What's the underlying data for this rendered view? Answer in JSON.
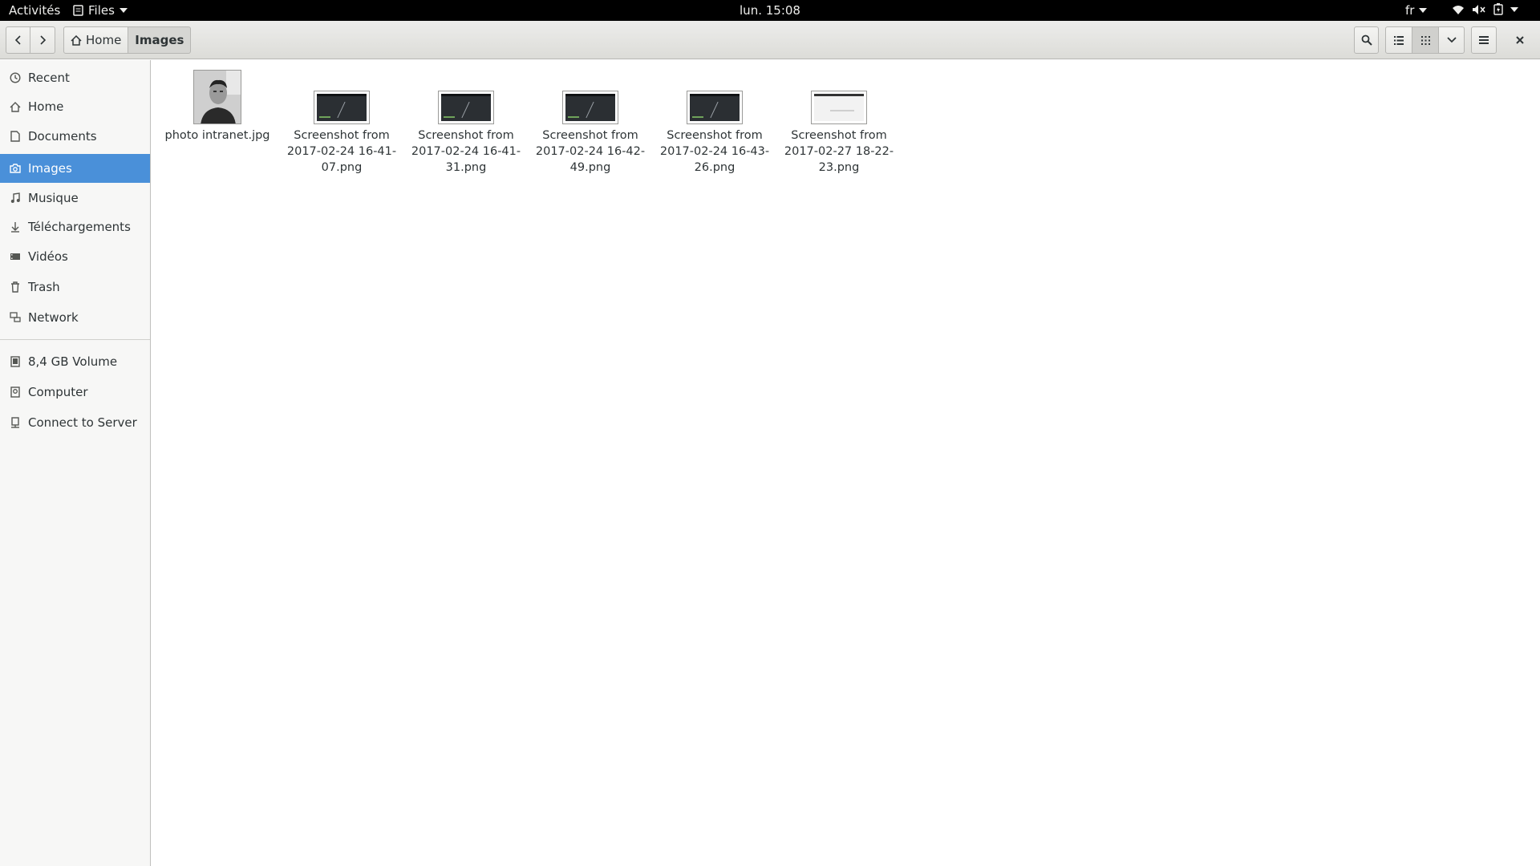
{
  "topbar": {
    "activities": "Activités",
    "app_name": "Files",
    "clock": "lun. 15:08",
    "language": "fr",
    "status_icons": [
      "wifi-icon",
      "volume-muted-icon",
      "battery-icon"
    ]
  },
  "headerbar": {
    "breadcrumbs": [
      "Home",
      "Images"
    ],
    "buttons": [
      "search-icon",
      "list-view-icon",
      "grid-view-icon",
      "chevron-down-icon",
      "hamburger-menu-icon",
      "close-icon"
    ]
  },
  "sidebar": {
    "selected": "Images",
    "items": [
      {
        "label": "Recent",
        "icon": "clock-icon"
      },
      {
        "label": "Home",
        "icon": "home-icon"
      },
      {
        "label": "Documents",
        "icon": "document-icon"
      },
      {
        "label": "Images",
        "icon": "camera-icon"
      },
      {
        "label": "Musique",
        "icon": "music-icon"
      },
      {
        "label": "Téléchargements",
        "icon": "download-icon"
      },
      {
        "label": "Vidéos",
        "icon": "video-icon"
      },
      {
        "label": "Trash",
        "icon": "trash-icon"
      },
      {
        "label": "Network",
        "icon": "network-icon"
      }
    ],
    "devices": [
      {
        "label": "8,4 GB Volume",
        "icon": "drive-icon"
      },
      {
        "label": "Computer",
        "icon": "computer-icon"
      },
      {
        "label": "Connect to Server",
        "icon": "server-icon"
      }
    ]
  },
  "files": [
    {
      "name": "photo intranet.jpg",
      "kind": "photo"
    },
    {
      "name": "Screenshot from 2017-02-24 16-41-07.png",
      "kind": "dark"
    },
    {
      "name": "Screenshot from 2017-02-24 16-41-31.png",
      "kind": "dark"
    },
    {
      "name": "Screenshot from 2017-02-24 16-42-49.png",
      "kind": "dark"
    },
    {
      "name": "Screenshot from 2017-02-24 16-43-26.png",
      "kind": "dark"
    },
    {
      "name": "Screenshot from 2017-02-27 18-22-23.png",
      "kind": "light"
    }
  ]
}
